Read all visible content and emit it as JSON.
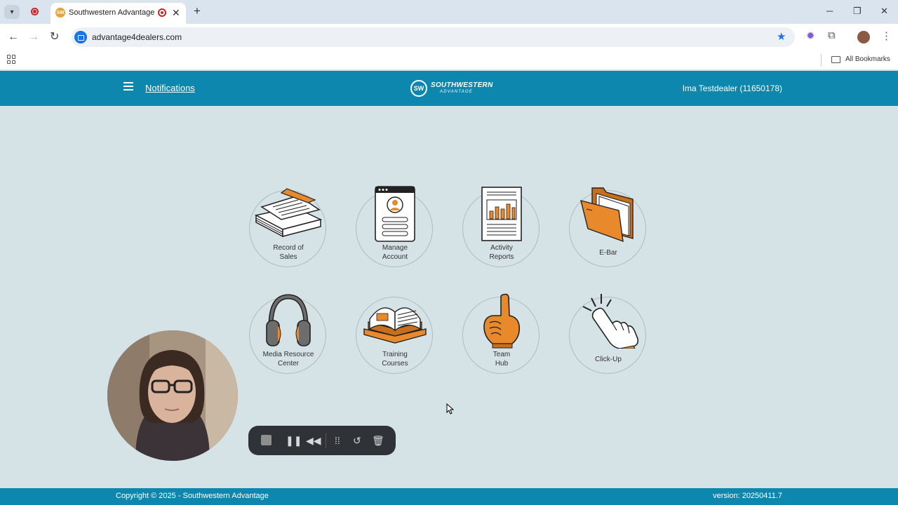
{
  "browser": {
    "tab_title": "Southwestern Advantage D",
    "tab_favicon_text": "SW",
    "url": "advantage4dealers.com",
    "bookmark_folder_label": "All Bookmarks"
  },
  "header": {
    "notifications_label": "Notifications",
    "logo_badge": "SW",
    "logo_line1": "SOUTHWESTERN",
    "logo_line2": "ADVANTAGE",
    "user_label": "Ima Testdealer (11650178)"
  },
  "tiles": [
    {
      "label_line1": "Record of",
      "label_line2": "Sales",
      "icon": "stacked-papers-icon"
    },
    {
      "label_line1": "Manage",
      "label_line2": "Account",
      "icon": "profile-card-icon"
    },
    {
      "label_line1": "Activity",
      "label_line2": "Reports",
      "icon": "bar-report-icon"
    },
    {
      "label": "E-Bar",
      "icon": "folder-icon"
    },
    {
      "label_line1": "Media Resource",
      "label_line2": "Center",
      "icon": "headphones-icon"
    },
    {
      "label_line1": "Training",
      "label_line2": "Courses",
      "icon": "open-book-icon"
    },
    {
      "label_line1": "Team",
      "label_line2": "Hub",
      "icon": "foam-finger-icon"
    },
    {
      "label": "Click-Up",
      "icon": "pointer-hand-icon"
    }
  ],
  "footer": {
    "copyright": "Copyright © 2025 - Southwestern Advantage",
    "version": "version: 20250411.7"
  },
  "colors": {
    "brand_blue": "#0e87af",
    "page_bg": "#d5e2e6",
    "accent_orange": "#e8892c"
  }
}
